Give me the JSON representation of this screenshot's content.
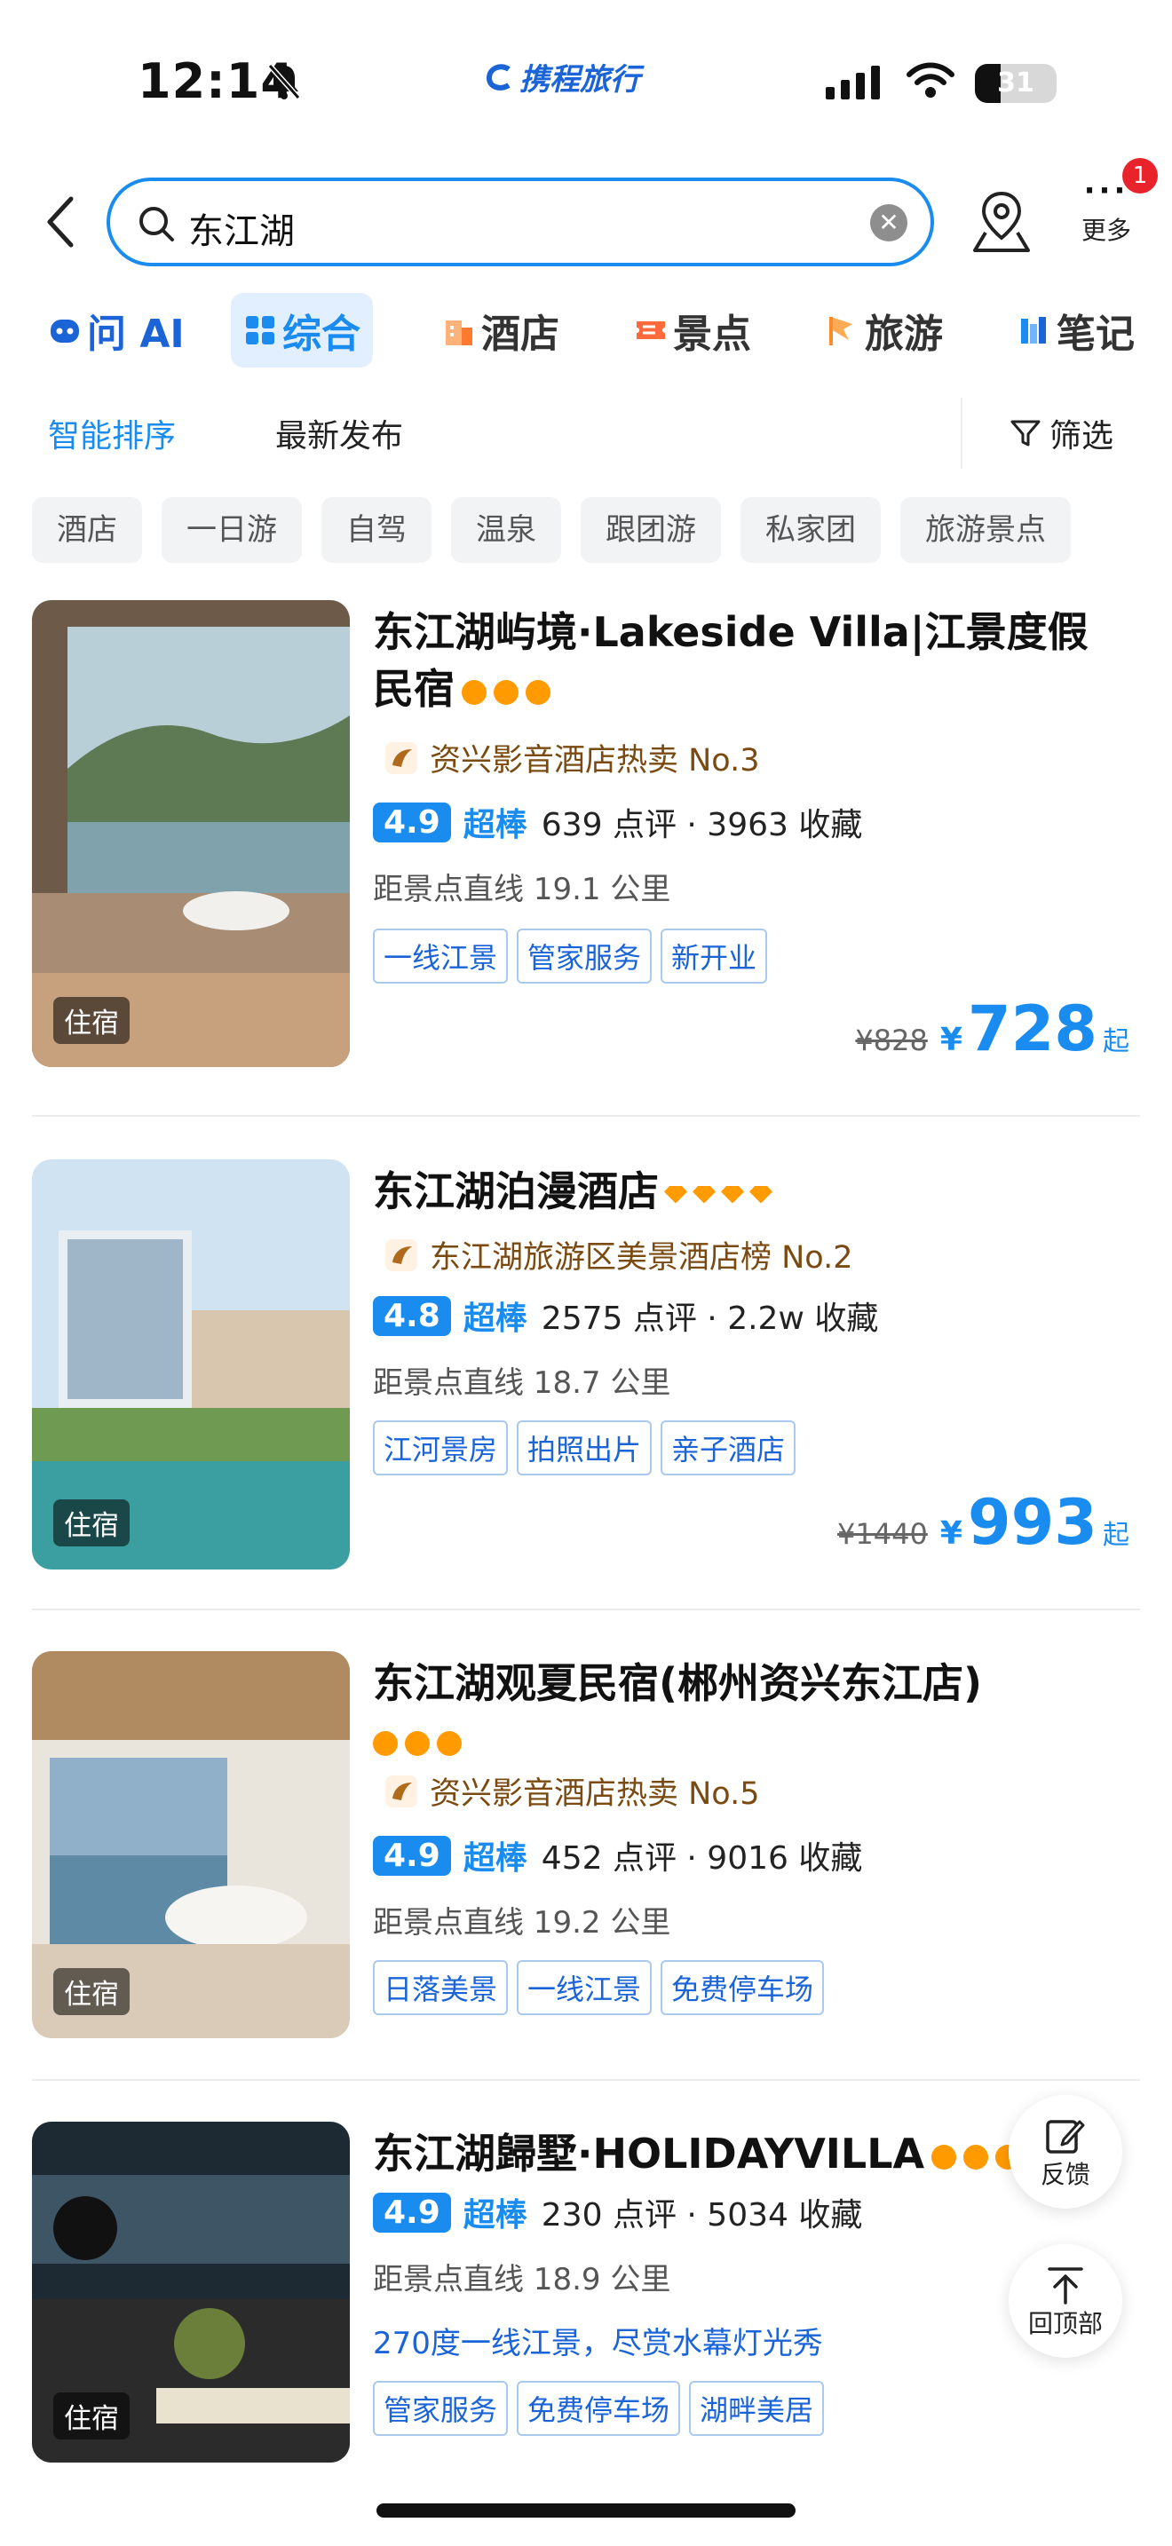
{
  "status_bar": {
    "time": "12:14",
    "brand": "携程旅行",
    "battery": "31",
    "battery_level": 0.31
  },
  "search": {
    "query": "东江湖",
    "more_label": "更多",
    "more_badge": "1"
  },
  "categories": [
    {
      "label": "问 AI",
      "icon": "ai-robot-icon"
    },
    {
      "label": "综合",
      "icon": "grid-icon"
    },
    {
      "label": "酒店",
      "icon": "hotel-icon"
    },
    {
      "label": "景点",
      "icon": "ticket-icon"
    },
    {
      "label": "旅游",
      "icon": "flag-icon"
    },
    {
      "label": "笔记",
      "icon": "notes-icon"
    }
  ],
  "sort": {
    "smart": "智能排序",
    "latest": "最新发布",
    "filter": "筛选"
  },
  "chips": [
    "酒店",
    "一日游",
    "自驾",
    "温泉",
    "跟团游",
    "私家团",
    "旅游景点"
  ],
  "listings": [
    {
      "title": "东江湖屿境·Lakeside Villa|江景度假民宿",
      "rank": "资兴影音酒店热卖 No.3",
      "score": "4.9",
      "score_word": "超棒",
      "reviews": "639 点评 · 3963 收藏",
      "distance": "距景点直线 19.1 公里",
      "tags": [
        "一线江景",
        "管家服务",
        "新开业"
      ],
      "orig_price": "¥828",
      "currency": "¥",
      "price": "728",
      "suffix": "起",
      "thumb_label": "住宿"
    },
    {
      "title": "东江湖泊漫酒店",
      "rank": "东江湖旅游区美景酒店榜 No.2",
      "score": "4.8",
      "score_word": "超棒",
      "reviews": "2575 点评 · 2.2w 收藏",
      "distance": "距景点直线 18.7 公里",
      "tags": [
        "江河景房",
        "拍照出片",
        "亲子酒店"
      ],
      "orig_price": "¥1440",
      "currency": "¥",
      "price": "993",
      "suffix": "起",
      "thumb_label": "住宿"
    },
    {
      "title": "东江湖观夏民宿(郴州资兴东江店)",
      "rank": "资兴影音酒店热卖 No.5",
      "score": "4.9",
      "score_word": "超棒",
      "reviews": "452 点评 · 9016 收藏",
      "distance": "距景点直线 19.2 公里",
      "tags": [
        "日落美景",
        "一线江景",
        "免费停车场"
      ],
      "thumb_label": "住宿"
    },
    {
      "title": "东江湖歸墅·HOLIDAYVILLA",
      "score": "4.9",
      "score_word": "超棒",
      "reviews": "230 点评 · 5034 收藏",
      "distance": "距景点直线 18.9 公里",
      "description": "270度一线江景，尽赏水幕灯光秀",
      "tags": [
        "管家服务",
        "免费停车场",
        "湖畔美居"
      ],
      "thumb_label": "住宿"
    }
  ],
  "floating": {
    "feedback": "反馈",
    "top": "回顶部"
  },
  "colors": {
    "accent": "#1a8cf0",
    "rank_text": "#7a4a10",
    "star": "#ff9a00"
  }
}
